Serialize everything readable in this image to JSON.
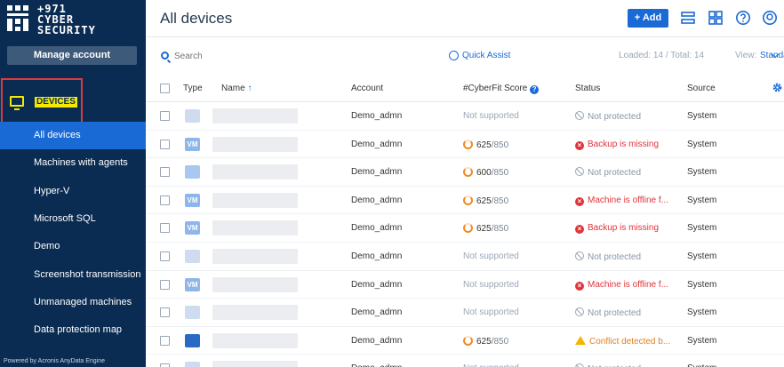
{
  "brand": {
    "logo_line1": "+971",
    "logo_line2": "CYBER",
    "logo_line3": "SECURITY",
    "manage_account": "Manage account",
    "powered_by": "Powered by Acronis AnyData Engine"
  },
  "sidebar": {
    "section": "DEVICES",
    "items": [
      {
        "label": "All devices",
        "active": true
      },
      {
        "label": "Machines with agents"
      },
      {
        "label": "Hyper-V"
      },
      {
        "label": "Microsoft SQL"
      },
      {
        "label": "Demo"
      },
      {
        "label": "Screenshot transmission"
      },
      {
        "label": "Unmanaged machines"
      },
      {
        "label": "Data protection map"
      }
    ]
  },
  "header": {
    "title": "All devices",
    "add_label": "+ Add",
    "icons": [
      "list-view-icon",
      "grid-view-icon",
      "help-icon",
      "user-icon"
    ]
  },
  "toolbar": {
    "search_placeholder": "Search",
    "quick_assist": "Quick Assist",
    "loaded": "Loaded: 14 / Total: 14",
    "view_label": "View:",
    "view_value": "Standard"
  },
  "table": {
    "columns": {
      "type": "Type",
      "name": "Name",
      "name_sort": "↑",
      "account": "Account",
      "score": "#CyberFit Score",
      "status": "Status",
      "source": "Source"
    },
    "rows": [
      {
        "type": "phys",
        "type_text": "",
        "account": "Demo_admn",
        "score": "Not supported",
        "score_of": "",
        "status": "Not protected",
        "status_kind": "none",
        "source": "System"
      },
      {
        "type": "vm",
        "type_text": "VM",
        "account": "Demo_admn",
        "score": "625",
        "score_of": "/850",
        "status": "Backup is missing",
        "status_kind": "err",
        "source": "System"
      },
      {
        "type": "win",
        "type_text": "",
        "account": "Demo_admn",
        "score": "600",
        "score_of": "/850",
        "status": "Not protected",
        "status_kind": "none",
        "source": "System"
      },
      {
        "type": "vm",
        "type_text": "VM",
        "account": "Demo_admn",
        "score": "625",
        "score_of": "/850",
        "status": "Machine is offline f...",
        "status_kind": "err",
        "source": "System"
      },
      {
        "type": "vm",
        "type_text": "VM",
        "account": "Demo_admn",
        "score": "625",
        "score_of": "/850",
        "status": "Backup is missing",
        "status_kind": "err",
        "source": "System"
      },
      {
        "type": "phys",
        "type_text": "",
        "account": "Demo_admn",
        "score": "Not supported",
        "score_of": "",
        "status": "Not protected",
        "status_kind": "none",
        "source": "System"
      },
      {
        "type": "vm",
        "type_text": "VM",
        "account": "Demo_admn",
        "score": "Not supported",
        "score_of": "",
        "status": "Machine is offline f...",
        "status_kind": "err",
        "source": "System"
      },
      {
        "type": "phys",
        "type_text": "",
        "account": "Demo_admn",
        "score": "Not supported",
        "score_of": "",
        "status": "Not protected",
        "status_kind": "none",
        "source": "System"
      },
      {
        "type": "windark",
        "type_text": "",
        "account": "Demo_admn",
        "score": "625",
        "score_of": "/850",
        "status": "Conflict detected b...",
        "status_kind": "warn",
        "source": "System"
      },
      {
        "type": "phys",
        "type_text": "",
        "account": "Demo_admn",
        "score": "Not supported",
        "score_of": "",
        "status": "Not protected",
        "status_kind": "none",
        "source": "System"
      }
    ]
  }
}
